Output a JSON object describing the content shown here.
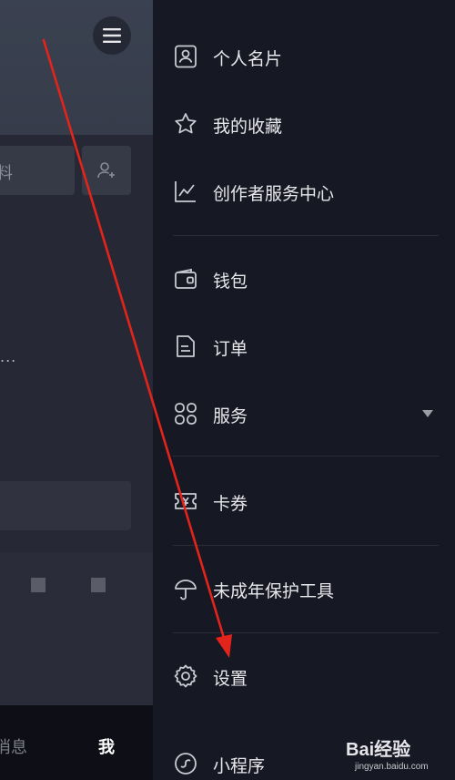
{
  "background_panel": {
    "edit_glyph": "料",
    "bio_ellipsis": "...",
    "tabs": {
      "messages": "消息",
      "me": "我"
    }
  },
  "drawer": {
    "items": [
      {
        "label": "个人名片",
        "icon": "id-card-icon"
      },
      {
        "label": "我的收藏",
        "icon": "star-icon"
      },
      {
        "label": "创作者服务中心",
        "icon": "line-chart-icon"
      },
      {
        "label": "钱包",
        "icon": "wallet-icon"
      },
      {
        "label": "订单",
        "icon": "order-document-icon"
      },
      {
        "label": "服务",
        "icon": "four-squares-icon",
        "expandable": true
      },
      {
        "label": "卡券",
        "icon": "ticket-icon"
      },
      {
        "label": "未成年保护工具",
        "icon": "umbrella-icon"
      },
      {
        "label": "设置",
        "icon": "gear-icon"
      },
      {
        "label": "小程序",
        "icon": "mini-program-icon"
      }
    ]
  },
  "watermark": {
    "brand": "Bai经验",
    "url": "jingyan.baidu.com"
  },
  "colors": {
    "drawer_bg": "#161823",
    "text": "#e8e8ec",
    "annotation_arrow": "#e3241b"
  }
}
